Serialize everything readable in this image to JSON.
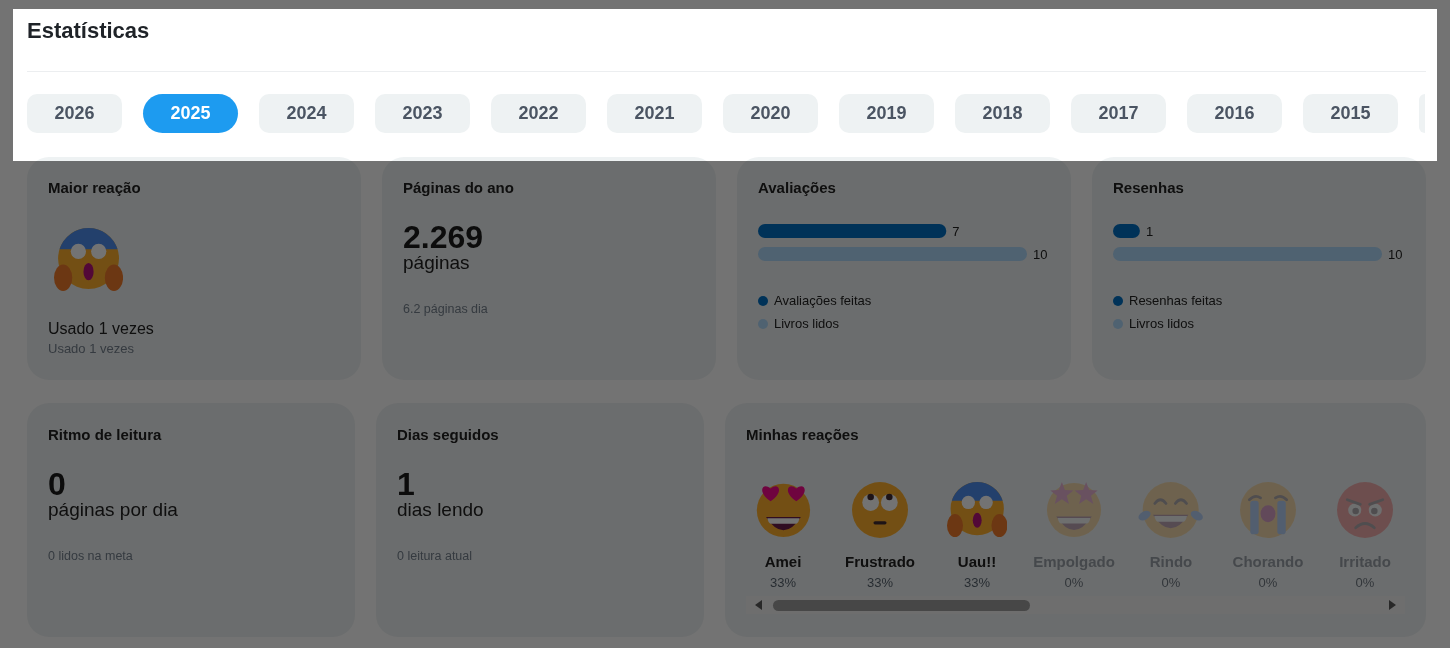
{
  "dim_overlay": {
    "on": true
  },
  "header": {
    "title": "Estatísticas",
    "year_tabs": [
      {
        "label": "2026",
        "selected": false,
        "cut_off": false
      },
      {
        "label": "2025",
        "selected": true,
        "cut_off": false
      },
      {
        "label": "2024",
        "selected": false,
        "cut_off": false
      },
      {
        "label": "2023",
        "selected": false,
        "cut_off": false
      },
      {
        "label": "2022",
        "selected": false,
        "cut_off": false
      },
      {
        "label": "2021",
        "selected": false,
        "cut_off": false
      },
      {
        "label": "2020",
        "selected": false,
        "cut_off": false
      },
      {
        "label": "2019",
        "selected": false,
        "cut_off": false
      },
      {
        "label": "2018",
        "selected": false,
        "cut_off": false
      },
      {
        "label": "2017",
        "selected": false,
        "cut_off": false
      },
      {
        "label": "2016",
        "selected": false,
        "cut_off": false
      },
      {
        "label": "2015",
        "selected": false,
        "cut_off": false
      },
      {
        "selected": false,
        "cut_off": true
      }
    ]
  },
  "top_reaction": {
    "title": "Maior reação",
    "emoji": {
      "kind": "scream"
    },
    "caption": "Usado 1 vezes",
    "note": "Usado 1 vezes"
  },
  "pages_of_year": {
    "title": "Páginas do ano",
    "value": "2.269",
    "unit": "páginas",
    "note": "6.2 páginas dia"
  },
  "ratings": {
    "title": "Avaliações",
    "chart_data": {
      "type": "bar",
      "orientation": "horizontal",
      "data_labels": true,
      "legend": "bottom",
      "series": [
        {
          "name": "Avaliações feitas",
          "color": "#0070c4",
          "values": [
            7
          ]
        },
        {
          "name": "Livros lidos",
          "color": "#b0d9fa",
          "values": [
            10
          ]
        }
      ]
    }
  },
  "reviews": {
    "title": "Resenhas",
    "chart_data": {
      "type": "bar",
      "orientation": "horizontal",
      "data_labels": true,
      "legend": "bottom",
      "series": [
        {
          "name": "Resenhas feitas",
          "color": "#0070c4",
          "values": [
            1
          ]
        },
        {
          "name": "Livros lidos",
          "color": "#b0d9fa",
          "values": [
            10
          ]
        }
      ]
    }
  },
  "reading_pace": {
    "title": "Ritmo de leitura",
    "value": "0",
    "unit": "páginas por dia",
    "note": "0 lidos na meta"
  },
  "streak": {
    "title": "Dias seguidos",
    "value": "1",
    "unit": "dias lendo",
    "note": "0 leitura atual"
  },
  "my_reactions": {
    "title": "Minhas reações",
    "reactions": [
      {
        "kind": "heart_eyes",
        "label": "Amei",
        "percent": "33%",
        "used": true
      },
      {
        "kind": "rolling_eyes",
        "label": "Frustrado",
        "percent": "33%",
        "used": true
      },
      {
        "kind": "scream",
        "label": "Uau!!",
        "percent": "33%",
        "used": true
      },
      {
        "kind": "star_struck",
        "label": "Empolgado",
        "percent": "0%",
        "used": false
      },
      {
        "kind": "laughing_tears",
        "label": "Rindo",
        "percent": "0%",
        "used": false
      },
      {
        "kind": "crying",
        "label": "Chorando",
        "percent": "0%",
        "used": false
      },
      {
        "kind": "angry",
        "label": "Irritado",
        "percent": "0%",
        "used": false
      }
    ]
  }
}
